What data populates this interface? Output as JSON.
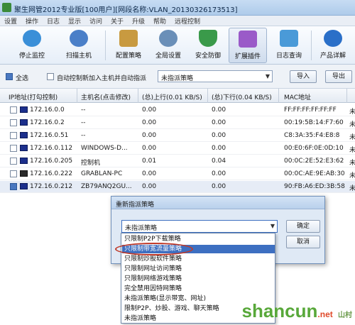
{
  "window": {
    "title": "聚生网管2012专业版[100用户][网段名称:VLAN_20130326173513]"
  },
  "menu": [
    "设置",
    "操作",
    "日志",
    "显示",
    "访问",
    "关于",
    "升级",
    "帮助",
    "远程控制"
  ],
  "toolbar": [
    {
      "label": "停止监控",
      "icon": "stop-monitor-icon",
      "color": "#3a8fd8"
    },
    {
      "label": "扫描主机",
      "icon": "scan-host-icon",
      "color": "#4a7fc8"
    },
    {
      "label": "配置策略",
      "icon": "config-policy-icon",
      "color": "#c89a40"
    },
    {
      "label": "全局设置",
      "icon": "global-settings-icon",
      "color": "#6a8fb8"
    },
    {
      "label": "安全防御",
      "icon": "security-shield-icon",
      "color": "#3a9a4a"
    },
    {
      "label": "扩展插件",
      "icon": "plugin-icon",
      "color": "#9a5ac8"
    },
    {
      "label": "日志查询",
      "icon": "log-query-icon",
      "color": "#4a9ad8"
    },
    {
      "label": "产品详解",
      "icon": "product-info-icon",
      "color": "#2a6fc8"
    }
  ],
  "filter": {
    "select_all": "全选",
    "auto_control": "自动控制新加入主机并自动指派",
    "policy_value": "未指派策略",
    "import": "导入",
    "export": "导出"
  },
  "table": {
    "headers": [
      "IP地址(打勾控制)",
      "主机名(点击修改)",
      "(总)上行(0.01 KB/S)",
      "(总)下行(0.04 KB/S)",
      "MAC地址"
    ],
    "rows": [
      {
        "ip": "172.16.0.0",
        "host": "--",
        "up": "0.00",
        "down": "0.00",
        "mac": "FF:FF:FF:FF:FF:FF",
        "extra": "未",
        "checked": false
      },
      {
        "ip": "172.16.0.2",
        "host": "--",
        "up": "0.00",
        "down": "0.00",
        "mac": "00:19:5B:14:F7:60",
        "extra": "未",
        "checked": false
      },
      {
        "ip": "172.16.0.51",
        "host": "--",
        "up": "0.00",
        "down": "0.00",
        "mac": "C8:3A:35:F4:E8:8",
        "extra": "未",
        "checked": false
      },
      {
        "ip": "172.16.0.112",
        "host": "WINDOWS-D...",
        "up": "0.00",
        "down": "0.00",
        "mac": "00:E0:6F:0E:0D:10",
        "extra": "未",
        "checked": false
      },
      {
        "ip": "172.16.0.205",
        "host": "控制机",
        "up": "0.01",
        "down": "0.04",
        "mac": "00:0C:2E:52:E3:62",
        "extra": "未",
        "checked": false
      },
      {
        "ip": "172.16.0.222",
        "host": "GRABLAN-PC",
        "up": "0.00",
        "down": "0.00",
        "mac": "00:0C:AE:9E:AB:30",
        "extra": "未",
        "checked": false
      },
      {
        "ip": "172.16.0.212",
        "host": "ZB79ANQ2GU...",
        "up": "0.00",
        "down": "0.00",
        "mac": "90:FB:A6:ED:3B:58",
        "extra": "未",
        "checked": true
      }
    ]
  },
  "dialog": {
    "title": "重新指派策略",
    "select_value": "未指派策略",
    "ok": "确定",
    "cancel": "取消"
  },
  "dropdown_options": [
    "只限制P2P下载策略",
    "只限制带宽流量策略",
    "只限制炒股软件策略",
    "只限制网址访问策略",
    "只限制网络游戏策略",
    "完全禁用因特网策略",
    "未指派策略(显示带宽、网址)",
    "限制P2P、炒股、游戏、聊天策略",
    "未指派策略"
  ],
  "watermark": {
    "main": "shancun",
    "suffix": ".net",
    "sub": "山村"
  }
}
